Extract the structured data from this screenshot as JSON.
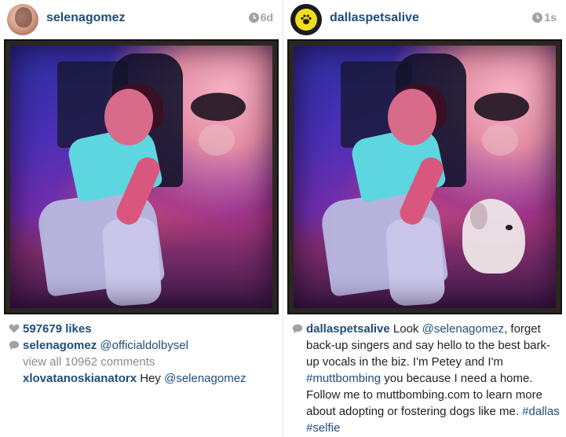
{
  "posts": [
    {
      "username": "selenagomez",
      "time": "6d",
      "likes": "597679 likes",
      "caption_user": "selenagomez",
      "caption_mention": "@officialdolbysel",
      "view_all": "view all 10962 comments",
      "comment_user": "xlovatanoskianatorx",
      "comment_text": "Hey",
      "comment_mention": "@selenagomez"
    },
    {
      "username": "dallaspetsalive",
      "time": "1s",
      "caption_user": "dallaspetsalive",
      "caption_parts": [
        {
          "text": "Look ",
          "kind": "text"
        },
        {
          "text": "@selenagomez",
          "kind": "link"
        },
        {
          "text": ", forget back-up singers and say hello to the best bark-up vocals in the biz. I'm Petey and I'm ",
          "kind": "text"
        },
        {
          "text": "#muttbombing",
          "kind": "link"
        },
        {
          "text": " you because I need a home. Follow me to muttbombing.com to learn more about adopting or fostering dogs like me. ",
          "kind": "text"
        },
        {
          "text": "#dallas",
          "kind": "link"
        },
        {
          "text": " ",
          "kind": "text"
        },
        {
          "text": "#selfie",
          "kind": "link"
        }
      ]
    }
  ],
  "colors": {
    "link": "#1e4d7a",
    "muted": "#a2a2a2",
    "brand_yellow": "#f2de1a"
  },
  "icons": [
    "clock-icon",
    "heart-icon",
    "comment-icon",
    "paw-icon"
  ]
}
